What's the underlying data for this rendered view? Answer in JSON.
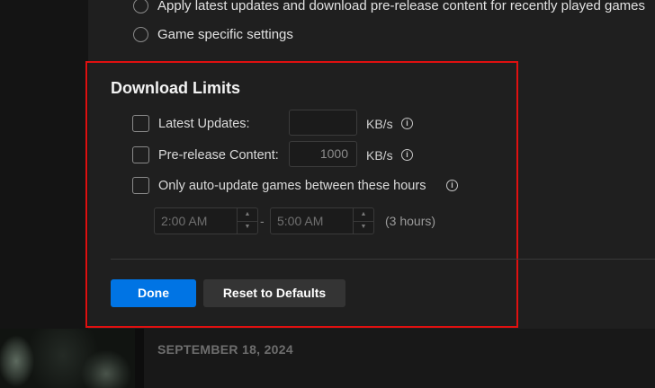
{
  "update_options": [
    {
      "label": "Apply latest updates and download pre-release content for recently played games"
    },
    {
      "label": "Game specific settings"
    }
  ],
  "download_limits": {
    "title": "Download Limits",
    "latest_updates": {
      "label": "Latest Updates:",
      "value": "",
      "unit": "KB/s",
      "checked": false
    },
    "prerelease": {
      "label": "Pre-release Content:",
      "value": "1000",
      "unit": "KB/s",
      "checked": false
    },
    "auto_update_hours": {
      "label": "Only auto-update games between these hours",
      "checked": false,
      "start_time": "2:00 AM",
      "end_time": "5:00 AM",
      "separator": "-",
      "duration": "(3 hours)"
    },
    "done_label": "Done",
    "reset_label": "Reset to Defaults"
  },
  "library": {
    "date": "SEPTEMBER 18, 2024"
  },
  "icons": {
    "info": "info-circle-icon",
    "stepper_up": "chevron-up-icon",
    "stepper_down": "chevron-down-icon"
  },
  "colors": {
    "accent": "#0074e4",
    "highlight_border": "#e01010",
    "panel_bg": "#1f1f1f"
  }
}
